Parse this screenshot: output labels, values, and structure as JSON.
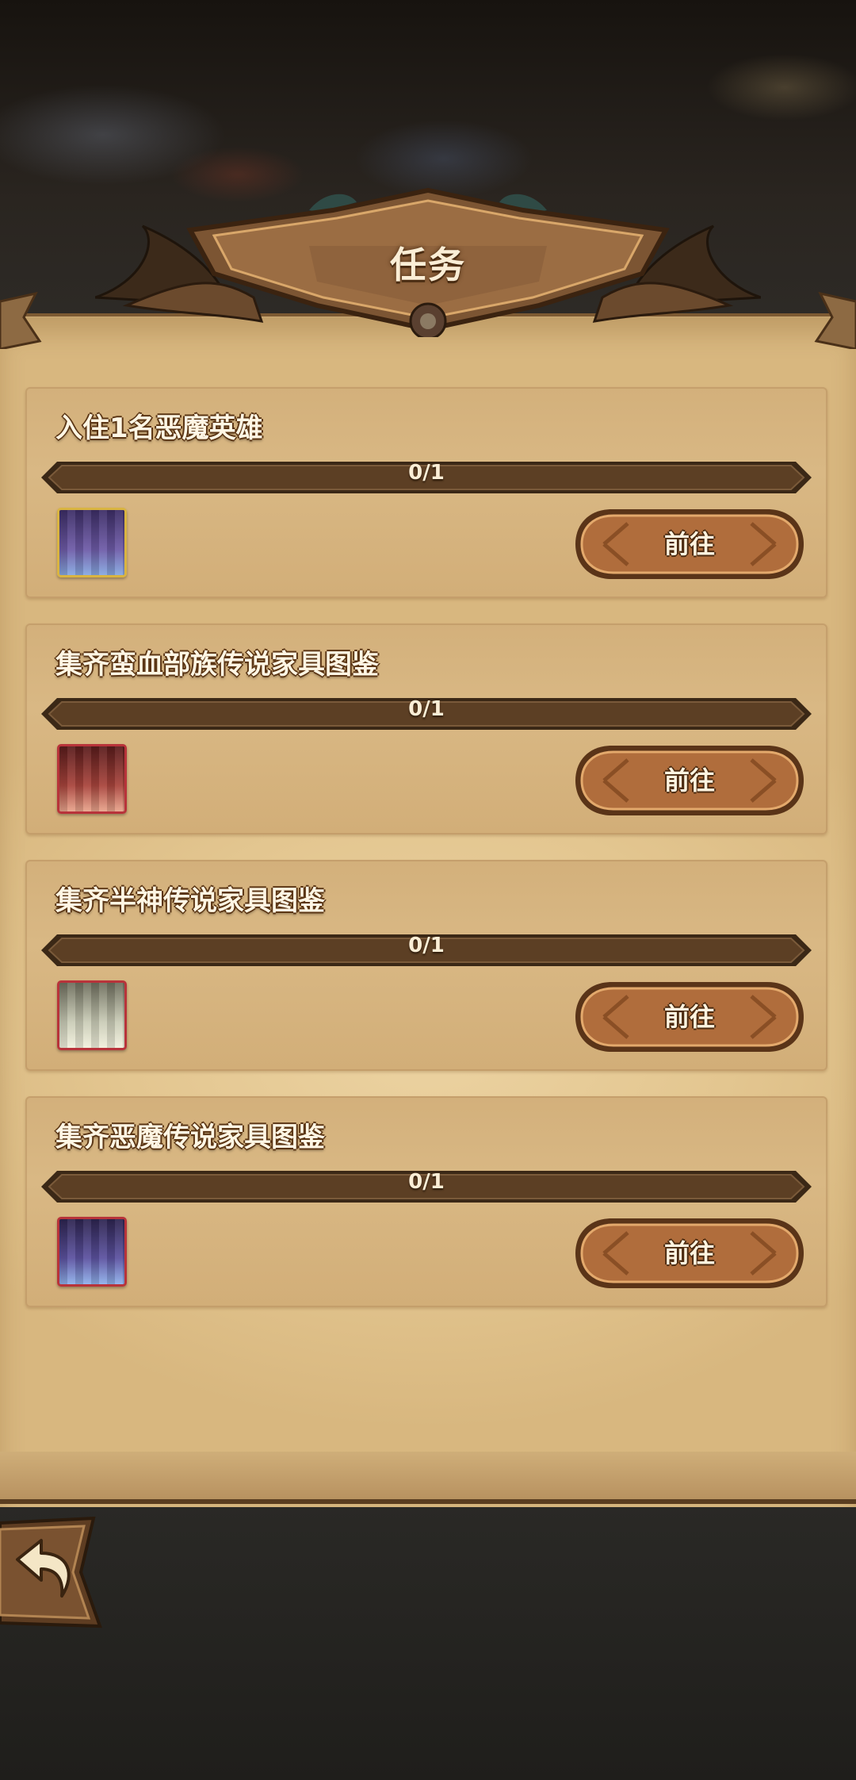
{
  "header": {
    "title": "任务"
  },
  "tasks": [
    {
      "title": "入住1名恶魔英雄",
      "progress_text": "0/1",
      "progress": 0,
      "reward_icon": "demon-hero-portrait-icon",
      "reward_frame_color": "#d9b441",
      "reward_tint": [
        "#3d2e66",
        "#6d5aa6",
        "#86a8e0"
      ],
      "button_label": "前往"
    },
    {
      "title": "集齐蛮血部族传说家具图鉴",
      "progress_text": "0/1",
      "progress": 0,
      "reward_icon": "barbarian-furniture-icon",
      "reward_frame_color": "#b8333a",
      "reward_tint": [
        "#5a1c1c",
        "#a8443c",
        "#e8a48c"
      ],
      "button_label": "前往"
    },
    {
      "title": "集齐半神传说家具图鉴",
      "progress_text": "0/1",
      "progress": 0,
      "reward_icon": "demigod-furniture-icon",
      "reward_frame_color": "#b8333a",
      "reward_tint": [
        "#6f6f5e",
        "#c9cbb6",
        "#f1f0dc"
      ],
      "button_label": "前往"
    },
    {
      "title": "集齐恶魔传说家具图鉴",
      "progress_text": "0/1",
      "progress": 0,
      "reward_icon": "demon-furniture-icon",
      "reward_frame_color": "#b8333a",
      "reward_tint": [
        "#2e2550",
        "#5c52a0",
        "#8fb0ea"
      ],
      "button_label": "前往"
    }
  ],
  "colors": {
    "parchment": "#e3c690",
    "card": "#d6b47f",
    "bar_track": "#5c3f24",
    "button": "#b06d3c",
    "title_outline": "#5a3514"
  },
  "back": {
    "icon": "back-arrow-icon"
  }
}
